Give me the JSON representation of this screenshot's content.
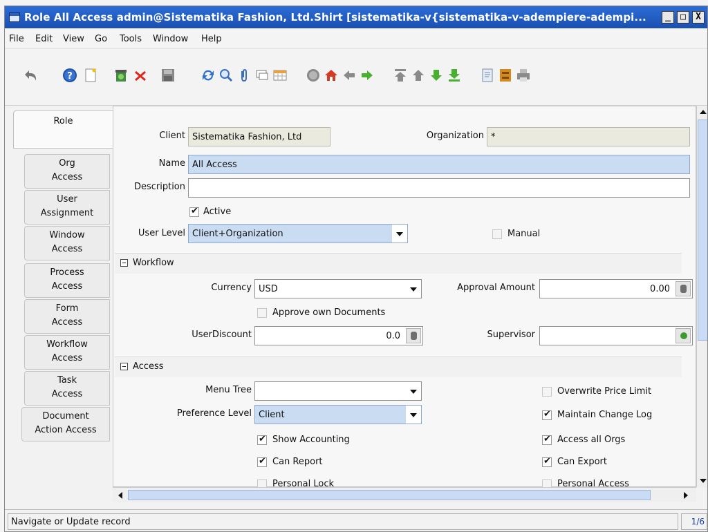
{
  "window": {
    "title": "Role  All Access  admin@Sistematika Fashion, Ltd.Shirt [sistematika-v{sistematika-v-adempiere-adempi...",
    "controls": [
      "_",
      "□",
      "X"
    ]
  },
  "menu": {
    "file": "File",
    "edit": "Edit",
    "view": "View",
    "go": "Go",
    "tools": "Tools",
    "window": "Window",
    "help": "Help"
  },
  "toolbar": {
    "icons": [
      "undo-icon",
      "help-icon",
      "new-record-icon",
      "copy-record-icon",
      "delete-icon",
      "save-icon",
      "refresh-icon",
      "find-icon",
      "attachment-icon",
      "chat-icon",
      "grid-toggle-icon",
      "history-icon",
      "home-icon",
      "back-icon",
      "forward-icon",
      "first-record-icon",
      "previous-record-icon",
      "next-record-icon",
      "last-record-icon",
      "report-icon",
      "archive-icon",
      "print-icon"
    ]
  },
  "tabs": {
    "main": "Role",
    "subtabs": [
      {
        "line1": "Org",
        "line2": "Access"
      },
      {
        "line1": "User",
        "line2": "Assignment"
      },
      {
        "line1": "Window",
        "line2": "Access"
      },
      {
        "line1": "Process",
        "line2": "Access"
      },
      {
        "line1": "Form",
        "line2": "Access"
      },
      {
        "line1": "Workflow",
        "line2": "Access"
      },
      {
        "line1": "Task",
        "line2": "Access"
      },
      {
        "line1": "Document",
        "line2": "Action Access"
      }
    ]
  },
  "form": {
    "client_label": "Client",
    "client_value": "Sistematika Fashion, Ltd",
    "org_label": "Organization",
    "org_value": "*",
    "name_label": "Name",
    "name_value": "All Access",
    "description_label": "Description",
    "description_value": "",
    "active_label": "Active",
    "active_checked": true,
    "user_level_label": "User Level",
    "user_level_value": "Client+Organization",
    "manual_label": "Manual",
    "manual_checked": false
  },
  "workflow": {
    "section_label": "Workflow",
    "currency_label": "Currency",
    "currency_value": "USD",
    "approval_amount_label": "Approval Amount",
    "approval_amount_value": "0.00",
    "approve_own_label": "Approve own Documents",
    "approve_own_checked": false,
    "user_discount_label": "UserDiscount",
    "user_discount_value": "0.0",
    "supervisor_label": "Supervisor",
    "supervisor_value": ""
  },
  "access": {
    "section_label": "Access",
    "menu_tree_label": "Menu Tree",
    "menu_tree_value": "",
    "overwrite_price_label": "Overwrite Price Limit",
    "overwrite_price_checked": false,
    "preference_level_label": "Preference Level",
    "preference_level_value": "Client",
    "maintain_change_log_label": "Maintain Change Log",
    "maintain_change_log_checked": true,
    "show_accounting_label": "Show Accounting",
    "show_accounting_checked": true,
    "access_all_orgs_label": "Access all Orgs",
    "access_all_orgs_checked": true,
    "can_report_label": "Can Report",
    "can_report_checked": true,
    "can_export_label": "Can Export",
    "can_export_checked": true,
    "personal_lock_label": "Personal Lock",
    "personal_lock_checked": false,
    "personal_access_label": "Personal Access",
    "personal_access_checked": false
  },
  "status": {
    "message": "Navigate or Update record",
    "record_count": "1/6"
  },
  "colors": {
    "titlebar": "#1b4fb0",
    "mandatory_field": "#c9dcf2",
    "readonly_field": "#ebeadf",
    "scroll_thumb": "#c9dbf5"
  }
}
